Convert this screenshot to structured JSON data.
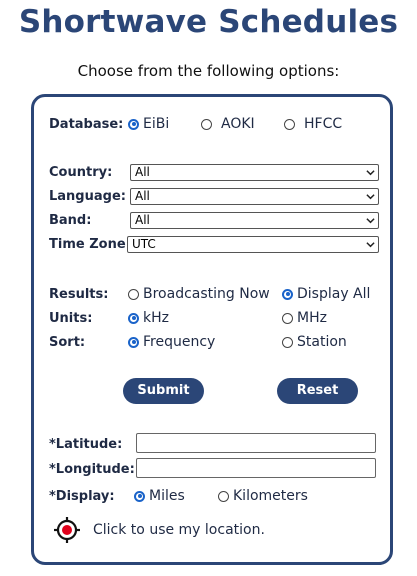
{
  "header": {
    "title": "Shortwave Schedules",
    "subtitle": "Choose from the following options:"
  },
  "database": {
    "label": "Database:",
    "options": [
      "EiBi",
      "AOKI",
      "HFCC"
    ],
    "selected": "EiBi"
  },
  "filters": {
    "country": {
      "label": "Country:",
      "value": "All"
    },
    "language": {
      "label": "Language:",
      "value": "All"
    },
    "band": {
      "label": "Band:",
      "value": "All"
    },
    "timezone": {
      "label": "Time Zone:",
      "value": "UTC"
    }
  },
  "results": {
    "label": "Results:",
    "options": [
      "Broadcasting Now",
      "Display All"
    ],
    "selected": "Display All"
  },
  "units": {
    "label": "Units:",
    "options": [
      "kHz",
      "MHz"
    ],
    "selected": "kHz"
  },
  "sort": {
    "label": "Sort:",
    "options": [
      "Frequency",
      "Station"
    ],
    "selected": "Frequency"
  },
  "buttons": {
    "submit": "Submit",
    "reset": "Reset"
  },
  "location": {
    "latitude_label": "*Latitude:",
    "latitude_value": "",
    "longitude_label": "*Longitude:",
    "longitude_value": "",
    "display_label": "*Display:",
    "display_options": [
      "Miles",
      "Kilometers"
    ],
    "display_selected": "Miles",
    "use_location_text": "Click to use my location."
  },
  "colors": {
    "brand": "#2b4677",
    "radio_accent": "#1a63c9",
    "locate_red": "#e0001b"
  },
  "icons": {
    "locate": "crosshair-target-icon",
    "dropdown": "chevron-down-icon"
  }
}
